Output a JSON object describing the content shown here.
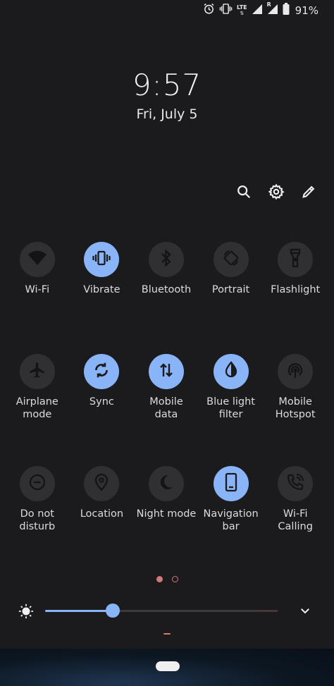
{
  "status_bar": {
    "network_label": "LTE",
    "roaming_label": "R",
    "battery": "91%"
  },
  "lockscreen": {
    "time": "9:57",
    "date": "Fri, July 5"
  },
  "quick_settings": {
    "rows": [
      [
        {
          "label": "Wi-Fi",
          "icon": "wifi-icon",
          "on": false
        },
        {
          "label": "Vibrate",
          "icon": "vibrate-icon",
          "on": true
        },
        {
          "label": "Bluetooth",
          "icon": "bluetooth-icon",
          "on": false
        },
        {
          "label": "Portrait",
          "icon": "rotate-icon",
          "on": false
        },
        {
          "label": "Flashlight",
          "icon": "flashlight-icon",
          "on": false
        }
      ],
      [
        {
          "label": "Airplane\nmode",
          "icon": "airplane-icon",
          "on": false
        },
        {
          "label": "Sync",
          "icon": "sync-icon",
          "on": true
        },
        {
          "label": "Mobile\ndata",
          "icon": "mobile-data-icon",
          "on": true
        },
        {
          "label": "Blue light\nfilter",
          "icon": "blue-light-filter-icon",
          "on": true
        },
        {
          "label": "Mobile\nHotspot",
          "icon": "hotspot-icon",
          "on": false
        }
      ],
      [
        {
          "label": "Do not\ndisturb",
          "icon": "do-not-disturb-icon",
          "on": false
        },
        {
          "label": "Location",
          "icon": "location-icon",
          "on": false
        },
        {
          "label": "Night mode",
          "icon": "night-mode-icon",
          "on": false
        },
        {
          "label": "Navigation\nbar",
          "icon": "navigation-bar-icon",
          "on": true
        },
        {
          "label": "Wi-Fi\nCalling",
          "icon": "wifi-calling-icon",
          "on": false
        }
      ]
    ],
    "page_count": 2,
    "current_page": 1
  },
  "brightness": {
    "level": 0.29
  },
  "colors": {
    "accent": "#8ab4f8",
    "tile_off": "#303033",
    "background": "#1b1b1d",
    "page_dot": "#d27a7a"
  }
}
